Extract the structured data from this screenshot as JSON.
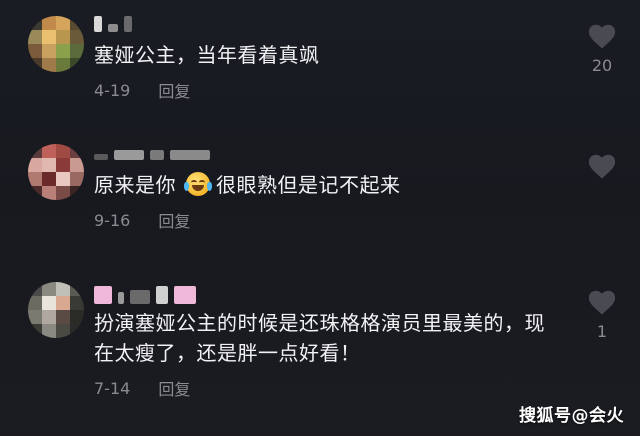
{
  "comments": [
    {
      "text": "塞娅公主，当年看着真飒",
      "date": "4-19",
      "reply_label": "回复",
      "likes": "20"
    },
    {
      "text_before_emoji": "原来是你",
      "emoji": "laugh-cry-emoji",
      "text_after_emoji": "很眼熟但是记不起来",
      "date": "9-16",
      "reply_label": "回复",
      "likes": ""
    },
    {
      "text": "扮演塞娅公主的时候是还珠格格演员里最美的，现在太瘦了，还是胖一点好看！",
      "date": "7-14",
      "reply_label": "回复",
      "likes": "1"
    }
  ],
  "watermark": "搜狐号@会火",
  "colors": {
    "background": "#17191f",
    "text": "#f2f2f4",
    "muted": "#8a8b91",
    "heart": "#4a4b52"
  }
}
